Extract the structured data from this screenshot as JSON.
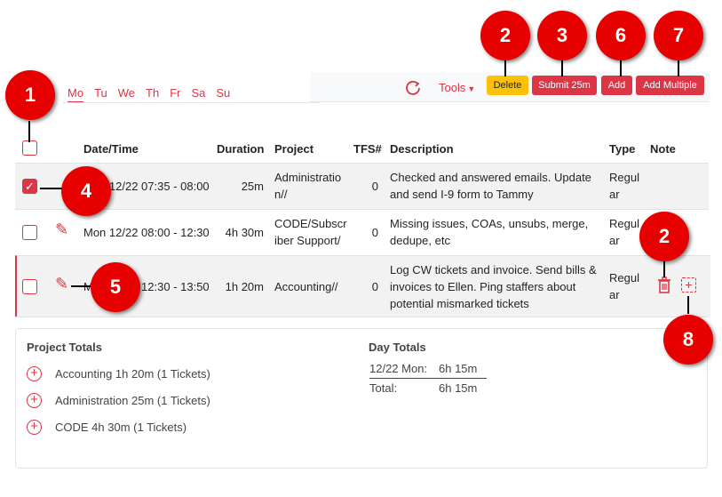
{
  "days": [
    "Mo",
    "Tu",
    "We",
    "Th",
    "Fr",
    "Sa",
    "Su"
  ],
  "toolbar": {
    "tools_label": "Tools",
    "delete_label": "Delete",
    "submit_label": "Submit 25m",
    "add_label": "Add",
    "add_multiple_label": "Add Multiple"
  },
  "table": {
    "headers": {
      "datetime": "Date/Time",
      "duration": "Duration",
      "project": "Project",
      "tfs": "TFS#",
      "description": "Description",
      "type": "Type",
      "note": "Note"
    },
    "rows": [
      {
        "datetime": "Mon 12/22 07:35 - 08:00",
        "duration": "25m",
        "project": "Administratio n//",
        "tfs": "0",
        "description": "Checked and answered emails. Update and send I-9 form to Tammy",
        "type": "Regul ar"
      },
      {
        "datetime": "Mon 12/22 08:00 - 12:30",
        "duration": "4h 30m",
        "project": "CODE/Subscr iber Support/",
        "tfs": "0",
        "description": "Missing issues, COAs, unsubs, merge, dedupe, etc",
        "type": "Regul ar"
      },
      {
        "datetime": "Mon 12/22 12:30 - 13:50",
        "duration": "1h 20m",
        "project": "Accounting//",
        "tfs": "0",
        "description": "Log CW tickets and invoice. Send bills & invoices to Ellen. Ping staffers about potential mismarked tickets",
        "type": "Regul ar"
      }
    ]
  },
  "totals": {
    "project_title": "Project Totals",
    "projects": [
      "Accounting 1h 20m (1 Tickets)",
      "Administration 25m (1 Tickets)",
      "CODE 4h 30m (1 Tickets)"
    ],
    "day_title": "Day Totals",
    "day_label": "12/22 Mon:",
    "day_value": "6h 15m",
    "total_label": "Total:",
    "total_value": "6h 15m"
  },
  "markers": [
    "1",
    "2",
    "3",
    "6",
    "7",
    "4",
    "5",
    "2",
    "8"
  ],
  "colors": {
    "accent": "#dc3545",
    "warning": "#ffc107",
    "marker": "#e60000"
  }
}
